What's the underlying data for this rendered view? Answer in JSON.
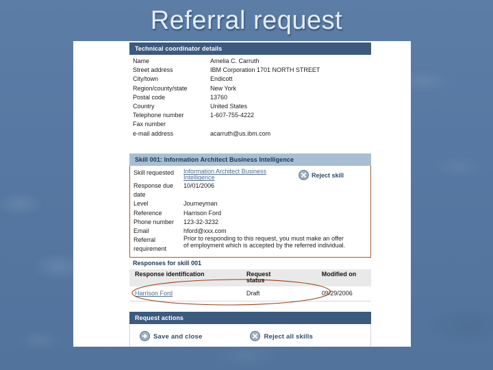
{
  "slide": {
    "title": "Referral request",
    "background_color": "#5678a2",
    "title_color": "#e4eef8"
  },
  "colors": {
    "bar_dark": "#3b5a7e",
    "bar_light": "#a8bed2",
    "link": "#4a6d93",
    "ink_annotation": "#9c3a14",
    "skill_box_border": "#9c5a36",
    "table_header_bg": "#e9e9e9"
  },
  "coordinator": {
    "header": "Technical coordinator details",
    "rows": [
      {
        "label": "Name",
        "value": "Amelia C. Carruth"
      },
      {
        "label": "Street address",
        "value": "IBM Corporation 1701 NORTH STREET"
      },
      {
        "label": "City/town",
        "value": "Endicott"
      },
      {
        "label": "Region/county/state",
        "value": "New York"
      },
      {
        "label": "Postal code",
        "value": "13760"
      },
      {
        "label": "Country",
        "value": "United States"
      },
      {
        "label": "Telephone number",
        "value": "1-607-755-4222"
      },
      {
        "label": "Fax number",
        "value": ""
      },
      {
        "label": "e-mail address",
        "value": "acarruth@us.ibm.com"
      }
    ]
  },
  "skill": {
    "header": "Skill 001: Information Architect Business Intelligence",
    "requested_label": "Skill requested",
    "requested_link_line1": "Information Architect Business",
    "requested_link_line2": "Intelligence",
    "reject_button": "Reject skill",
    "reject_icon": "x-circle-icon",
    "rows": [
      {
        "label": "Response due",
        "label2": "date",
        "value": "10/01/2006"
      },
      {
        "label": "Level",
        "value": "Journeyman"
      },
      {
        "label": "Reference",
        "value": "Harrison Ford"
      },
      {
        "label": "Phone number",
        "value": "123-32-3232"
      },
      {
        "label": "Email",
        "value": "hford@xxx.com"
      }
    ],
    "requirement_label": "Referral",
    "requirement_label2": "requirement",
    "requirement_line1": "Prior to responding to this request, you must make an offer",
    "requirement_line2": "of employment which is accepted by the referred individual."
  },
  "responses": {
    "header": "Responses for skill 001",
    "columns": [
      "Response identification",
      "Request status",
      "Modified on"
    ],
    "column_status_line1": "Request",
    "column_status_line2": "status",
    "rows": [
      {
        "identification": "Harrison Ford",
        "status": "Draft",
        "modified_on": "09/29/2006"
      }
    ]
  },
  "request_actions": {
    "header": "Request actions",
    "buttons": [
      {
        "label": "Save and close",
        "icon": "arrow-right-circle-icon"
      },
      {
        "label": "Reject all skills",
        "icon": "x-circle-icon"
      }
    ]
  }
}
